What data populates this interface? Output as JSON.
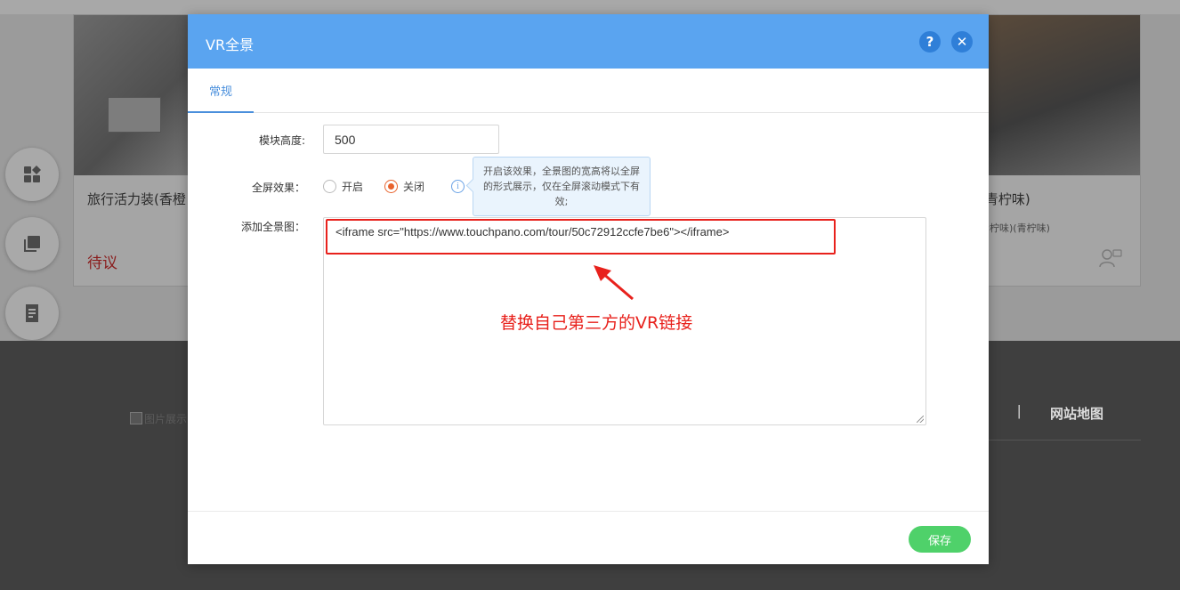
{
  "background": {
    "card_left": {
      "title": "旅行活力装(香橙",
      "price": "待议"
    },
    "card_right": {
      "title": "(青柠味)",
      "subtitle": "青柠味)(青柠味)"
    },
    "footer": {
      "separator": "|",
      "link": "网站地图",
      "image_alt": "图片展示"
    },
    "side_pill": "••••••"
  },
  "dialog": {
    "title": "VR全景",
    "help_symbol": "?",
    "close_symbol": "✕",
    "tabs": [
      {
        "label": "常规",
        "active": true
      }
    ],
    "height_label": "模块高度:",
    "height_value": "500",
    "fullscreen_label": "全屏效果：",
    "fullscreen_options": [
      {
        "label": "开启",
        "checked": false
      },
      {
        "label": "关闭",
        "checked": true
      }
    ],
    "info_symbol": "i",
    "tooltip": "开启该效果，全景图的宽高将以全屏的形式展示，仅在全屏滚动模式下有效;",
    "add_label": "添加全景图：",
    "embed_code": "<iframe src=\"https://www.touchpano.com/tour/50c72912ccfe7be6\"></iframe>",
    "annotation": "替换自己第三方的VR链接",
    "save_label": "保存"
  },
  "colors": {
    "header_blue": "#5aa4f0",
    "accent_blue": "#4a8fdc",
    "radio_orange": "#e8622c",
    "annotation_red": "#e8211c",
    "save_green": "#4fd16a"
  }
}
